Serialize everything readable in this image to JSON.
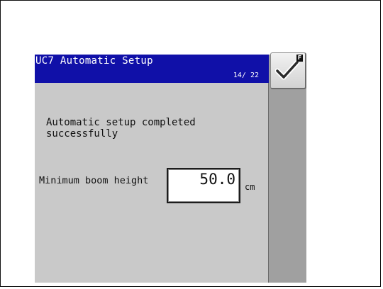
{
  "window": {
    "title": "UC7 Automatic Setup",
    "page_indicator": "14/ 22"
  },
  "main": {
    "message": "Automatic setup completed successfully",
    "field": {
      "label": "Minimum boom height",
      "value": "50.0",
      "unit": "cm"
    }
  },
  "softkeys": [
    {
      "icon": "checkmark-icon",
      "badge": "F"
    }
  ],
  "colors": {
    "titlebar": "#1010a8",
    "content_bg": "#c9c9c9",
    "softkey_column": "#a0a0a0"
  }
}
